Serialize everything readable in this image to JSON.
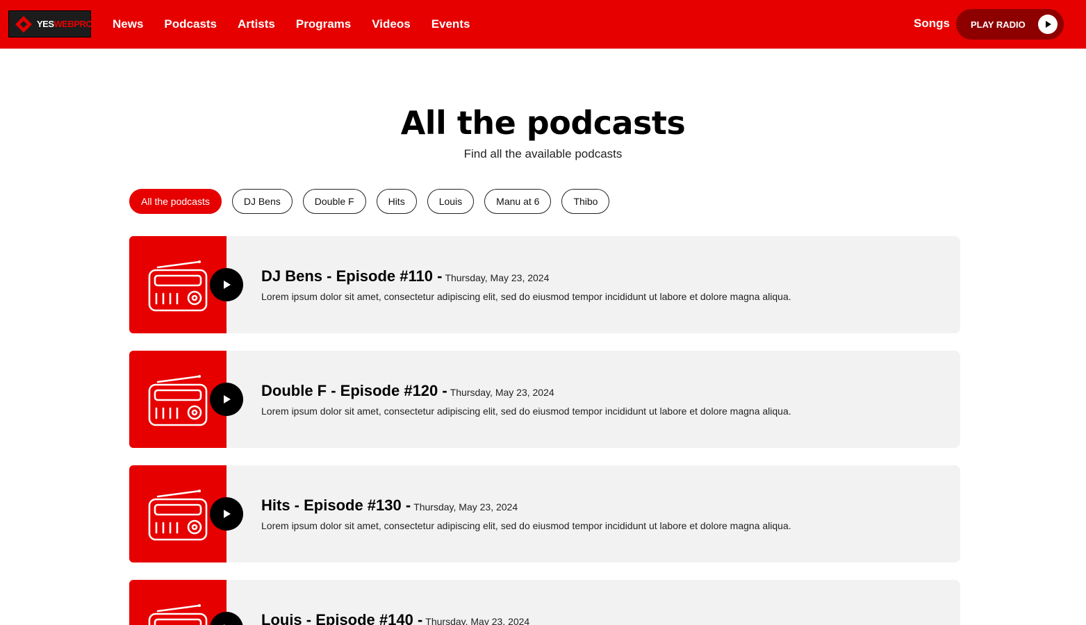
{
  "header": {
    "logo": {
      "text_yes": "YES",
      "text_brand": "WEBPRO"
    },
    "nav": [
      "News",
      "Podcasts",
      "Artists",
      "Programs",
      "Videos",
      "Events"
    ],
    "songs_label": "Songs",
    "play_radio_label": "PLAY RADIO"
  },
  "page": {
    "title": "All the podcasts",
    "subtitle": "Find all the available podcasts"
  },
  "filters": [
    {
      "label": "All the podcasts",
      "active": true
    },
    {
      "label": "DJ Bens",
      "active": false
    },
    {
      "label": "Double F",
      "active": false
    },
    {
      "label": "Hits",
      "active": false
    },
    {
      "label": "Louis",
      "active": false
    },
    {
      "label": "Manu at 6",
      "active": false
    },
    {
      "label": "Thibo",
      "active": false
    }
  ],
  "episodes": [
    {
      "title": "DJ Bens - Episode #110 -",
      "date": "Thursday, May 23, 2024",
      "description": "Lorem ipsum dolor sit amet, consectetur adipiscing elit, sed do eiusmod tempor incididunt ut labore et dolore magna aliqua."
    },
    {
      "title": "Double F - Episode #120 -",
      "date": "Thursday, May 23, 2024",
      "description": "Lorem ipsum dolor sit amet, consectetur adipiscing elit, sed do eiusmod tempor incididunt ut labore et dolore magna aliqua."
    },
    {
      "title": "Hits - Episode #130 -",
      "date": "Thursday, May 23, 2024",
      "description": "Lorem ipsum dolor sit amet, consectetur adipiscing elit, sed do eiusmod tempor incididunt ut labore et dolore magna aliqua."
    },
    {
      "title": "Louis - Episode #140 -",
      "date": "Thursday, May 23, 2024",
      "description": ""
    }
  ],
  "icons": {
    "episode_thumbnail": "radio-icon",
    "episode_play": "play-icon",
    "radio_play": "play-icon",
    "logo": "diamond-logo-icon"
  },
  "colors": {
    "brand_red": "#e60000",
    "dark_red": "#8e0000",
    "card_bg": "#f2f2f2",
    "text": "#111111"
  }
}
